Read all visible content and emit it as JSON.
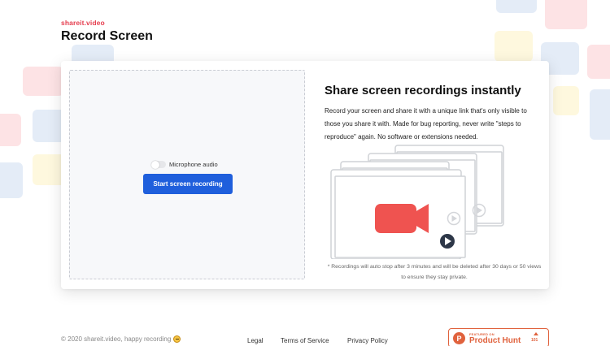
{
  "brand": "shareit.video",
  "page_title": "Record Screen",
  "recorder": {
    "microphone_label": "Microphone audio",
    "microphone_enabled": false,
    "start_button": "Start screen recording"
  },
  "info": {
    "headline": "Share screen recordings instantly",
    "description": "Record your screen and share it with a unique link that's only visible to those you share it with. Made for bug reporting, never write \"steps to reproduce\" again. No software or extensions needed.",
    "footnote": "* Recordings will auto stop after 3 minutes and will be deleted after 30 days or 50 views to ensure they stay private."
  },
  "footer": {
    "copyright": "© 2020 shareit.video, happy recording",
    "links": [
      "Legal",
      "Terms of Service",
      "Privacy Policy"
    ],
    "product_hunt": {
      "featured_label": "FEATURED ON",
      "name": "Product Hunt",
      "upvotes": "101"
    }
  },
  "colors": {
    "accent_red": "#e53e4f",
    "button_blue": "#1f5fdc",
    "camera_red": "#ef5350",
    "product_hunt": "#e0623d"
  },
  "icons": [
    "video-camera-icon",
    "play-icon",
    "toggle-switch",
    "product-hunt-logo-icon",
    "upvote-triangle-icon",
    "smile-emoji-icon"
  ]
}
